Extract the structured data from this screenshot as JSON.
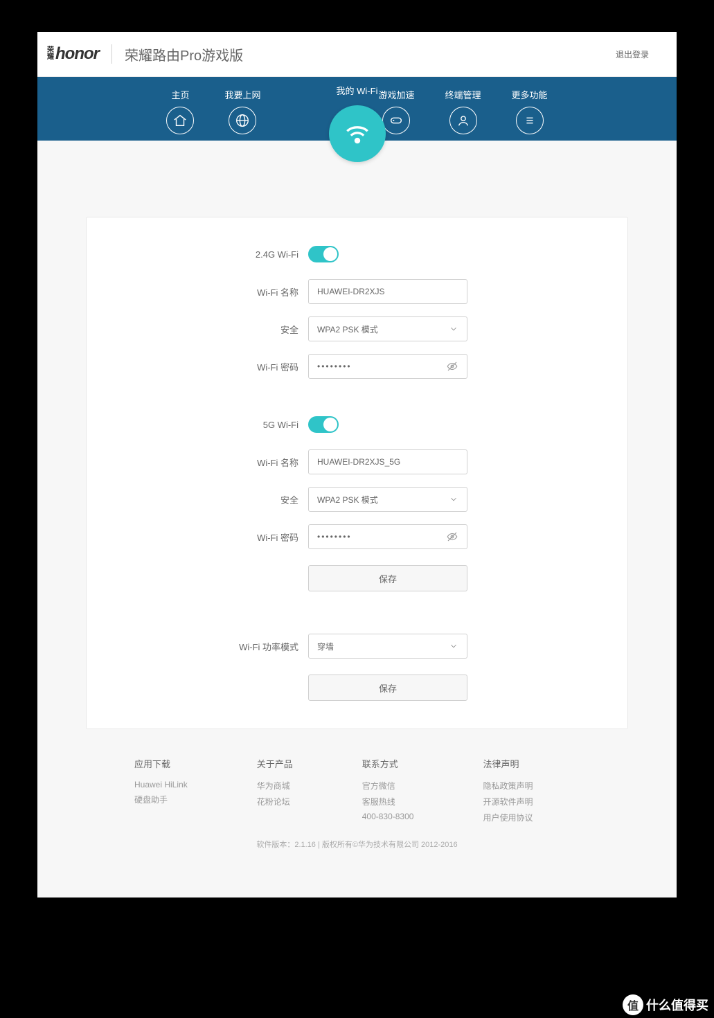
{
  "header": {
    "logo_cn_1": "荣",
    "logo_cn_2": "耀",
    "logo_en": "honor",
    "product_name": "荣耀路由Pro游戏版",
    "logout": "退出登录"
  },
  "nav": {
    "items": [
      {
        "label": "主页"
      },
      {
        "label": "我要上网"
      },
      {
        "label": "我的 Wi-Fi"
      },
      {
        "label": "游戏加速"
      },
      {
        "label": "终端管理"
      },
      {
        "label": "更多功能"
      }
    ]
  },
  "wifi24": {
    "toggle_label": "2.4G Wi-Fi",
    "name_label": "Wi-Fi 名称",
    "name_value": "HUAWEI-DR2XJS",
    "security_label": "安全",
    "security_value": "WPA2 PSK 模式",
    "pwd_label": "Wi-Fi 密码",
    "pwd_value": "••••••••"
  },
  "wifi5": {
    "toggle_label": "5G Wi-Fi",
    "name_label": "Wi-Fi 名称",
    "name_value": "HUAWEI-DR2XJS_5G",
    "security_label": "安全",
    "security_value": "WPA2 PSK 模式",
    "pwd_label": "Wi-Fi 密码",
    "pwd_value": "••••••••"
  },
  "save_label": "保存",
  "power": {
    "label": "Wi-Fi 功率模式",
    "value": "穿墙"
  },
  "footer": {
    "col1": {
      "head": "应用下载",
      "l1": "Huawei HiLink",
      "l2": "硬盘助手"
    },
    "col2": {
      "head": "关于产品",
      "l1": "华为商城",
      "l2": "花粉论坛"
    },
    "col3": {
      "head": "联系方式",
      "l1": "官方微信",
      "l2": "客服热线",
      "l3": "400-830-8300"
    },
    "col4": {
      "head": "法律声明",
      "l1": "隐私政策声明",
      "l2": "开源软件声明",
      "l3": "用户使用协议"
    },
    "bottom": "软件版本：2.1.16  |  版权所有©华为技术有限公司 2012-2016"
  },
  "watermark": "什么值得买"
}
